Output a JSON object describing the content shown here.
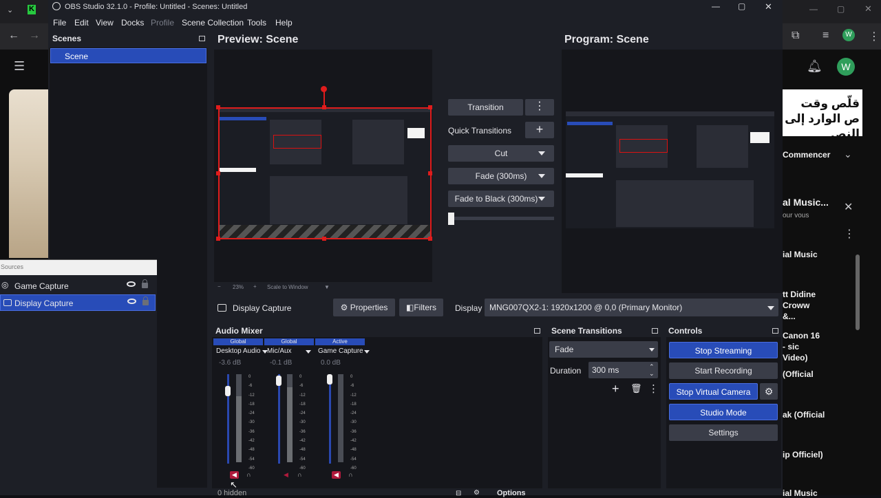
{
  "window": {
    "title": "OBS Studio 32.1.0 - Profile: Untitled - Scenes: Untitled"
  },
  "menu": [
    "File",
    "Edit",
    "View",
    "Docks",
    "Profile",
    "Scene Collection",
    "Tools",
    "Help"
  ],
  "scenes": {
    "title": "Scenes",
    "items": [
      "Scene"
    ]
  },
  "sources": {
    "title": "Sources",
    "items": [
      {
        "name": "Game Capture"
      },
      {
        "name": "Display Capture"
      }
    ],
    "hidden": "0 hidden"
  },
  "preview": {
    "title": "Preview: Scene",
    "zoom": "23%",
    "scale_mode": "Scale to Window"
  },
  "program": {
    "title": "Program: Scene"
  },
  "transitions_panel": {
    "transition": "Transition",
    "quick_label": "Quick Transitions",
    "buttons": [
      "Cut",
      "Fade (300ms)",
      "Fade to Black (300ms)"
    ]
  },
  "context": {
    "source": "Display Capture",
    "properties": "Properties",
    "filters": "Filters",
    "display_label": "Display",
    "display_value": "MNG007QX2-1: 1920x1200 @ 0,0 (Primary Monitor)"
  },
  "audio_mixer": {
    "title": "Audio Mixer",
    "channels": [
      {
        "tag": "Global",
        "name": "Desktop Audio",
        "db": "-3.6 dB",
        "fader": 0.85,
        "level": 0.75
      },
      {
        "tag": "Global",
        "name": "Mic/Aux",
        "db": "-0.1 dB",
        "fader": 0.98,
        "level": 0.85
      },
      {
        "tag": "Active",
        "name": "Game Capture",
        "db": "0.0 dB",
        "fader": 1.0,
        "level": 0.0
      }
    ],
    "ticks": [
      "0",
      "-6",
      "-12",
      "-18",
      "-24",
      "-30",
      "-36",
      "-42",
      "-48",
      "-54",
      "-60"
    ],
    "options": "Options"
  },
  "scene_transitions": {
    "title": "Scene Transitions",
    "type": "Fade",
    "duration_label": "Duration",
    "duration": "300 ms"
  },
  "controls": {
    "title": "Controls",
    "stop_streaming": "Stop Streaming",
    "start_recording": "Start Recording",
    "stop_virtual_camera": "Stop Virtual Camera",
    "studio_mode": "Studio Mode",
    "settings": "Settings"
  },
  "browser": {
    "ad_text": "قلّص وقت ص الوارد إلى النص",
    "commencer": "Commencer",
    "playlist_title": "al Music...",
    "playlist_sub": "our vous",
    "items": [
      "ial Music",
      "tt Didine Croww &...",
      "Canon 16 - sic Video)",
      "(Official",
      "ak (Official",
      "ip Officiel)",
      "ial Music"
    ]
  },
  "colors": {
    "accent": "#284cb8",
    "selection": "#e01c1c",
    "panel": "#1d1f26"
  }
}
